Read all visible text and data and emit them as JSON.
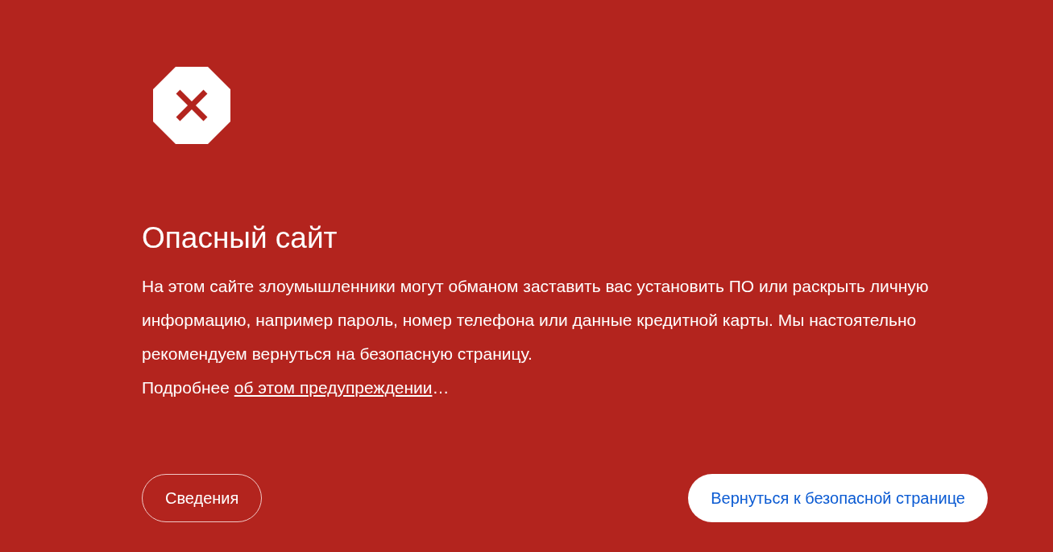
{
  "title": "Опасный сайт",
  "message": {
    "text": "На этом сайте злоумышленники могут обманом заставить вас установить ПО или раскрыть личную информацию, например пароль, номер телефона или данные кредитной карты. Мы настоятельно рекомендуем вернуться на безопасную страницу.",
    "more_prefix": "Подробнее",
    "link": "об этом предупреждении",
    "suffix": "…"
  },
  "buttons": [
    {
      "label": "Сведения",
      "kind": "secondary"
    },
    {
      "label": "Вернуться к безопасной странице",
      "kind": "primary"
    }
  ]
}
